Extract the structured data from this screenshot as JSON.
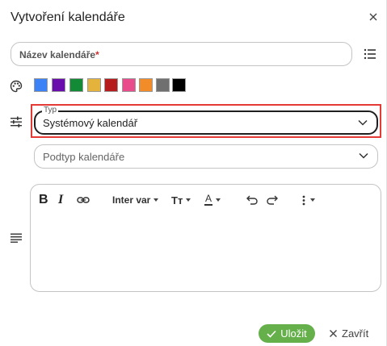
{
  "dialog": {
    "title": "Vytvoření kalendáře",
    "close_icon": "close-icon"
  },
  "name_field": {
    "label": "Název kalendáře",
    "required_mark": "*",
    "value": "",
    "side_icon": "list-icon"
  },
  "colors": {
    "icon": "palette-icon",
    "swatches": [
      "#3b82f6",
      "#6a0dad",
      "#138a36",
      "#e3b33b",
      "#b71c1c",
      "#e84c8b",
      "#f28c28",
      "#707070",
      "#000000"
    ]
  },
  "type_field": {
    "icon": "tune-icon",
    "legend": "Typ",
    "value": "Systémový kalendář",
    "highlight_color": "#e53935"
  },
  "subtype_field": {
    "placeholder": "Podtyp kalendáře"
  },
  "editor": {
    "icon": "notes-icon",
    "toolbar": {
      "bold": "B",
      "italic": "I",
      "link_icon": "link-icon",
      "font_label": "Inter var",
      "text_size": "Tт",
      "text_color": "A",
      "undo_icon": "undo-icon",
      "redo_icon": "redo-icon",
      "more_icon": "more-vertical-icon"
    },
    "content": ""
  },
  "footer": {
    "save_label": "Uložit",
    "close_label": "Zavřít",
    "save_color": "#66b04c"
  }
}
